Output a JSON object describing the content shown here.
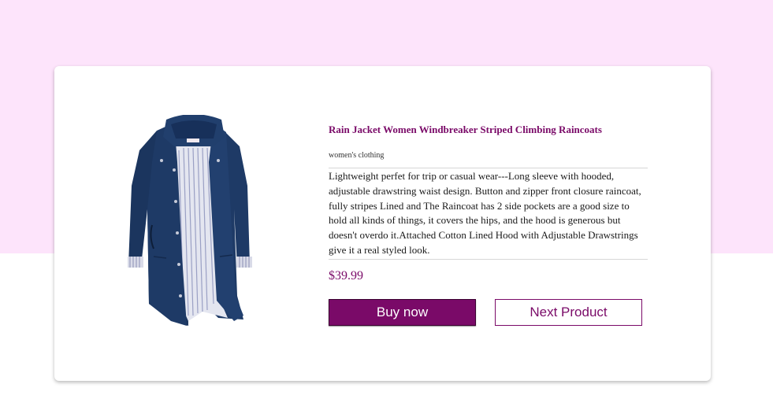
{
  "product": {
    "title": "Rain Jacket Women Windbreaker Striped Climbing Raincoats",
    "category": "women's clothing",
    "description": "Lightweight perfet for trip or casual wear---Long sleeve with hooded, adjustable drawstring waist design. Button and zipper front closure raincoat, fully stripes Lined and The Raincoat has 2 side pockets are a good size to hold all kinds of things, it covers the hips, and the hood is generous but doesn't overdo it.Attached Cotton Lined Hood with Adjustable Drawstrings give it a real styled look.",
    "price": "$39.99",
    "image_icon": "rain-jacket-image"
  },
  "actions": {
    "buy_label": "Buy now",
    "next_label": "Next Product"
  },
  "colors": {
    "page_top_bg": "#fde4fb",
    "accent": "#7a0a68",
    "card_bg": "#ffffff",
    "jacket_navy": "#1e3a66"
  }
}
